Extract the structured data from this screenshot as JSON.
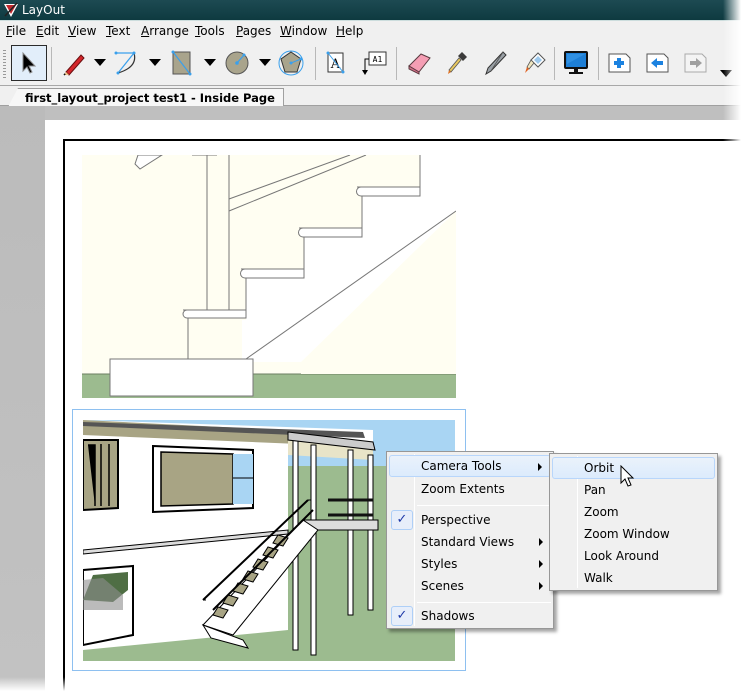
{
  "window": {
    "title": "LayOut"
  },
  "menubar": {
    "items": [
      {
        "label": "File",
        "accel": "F",
        "rest": "ile"
      },
      {
        "label": "Edit",
        "accel": "E",
        "rest": "dit"
      },
      {
        "label": "View",
        "accel": "V",
        "rest": "iew"
      },
      {
        "label": "Text",
        "accel": "T",
        "rest": "ext"
      },
      {
        "label": "Arrange",
        "accel": "A",
        "rest": "rrange"
      },
      {
        "label": "Tools",
        "accel": "T",
        "rest": "ools"
      },
      {
        "label": "Pages",
        "accel": "P",
        "rest": "ages"
      },
      {
        "label": "Window",
        "accel": "W",
        "rest": "indow"
      },
      {
        "label": "Help",
        "accel": "H",
        "rest": "elp"
      }
    ]
  },
  "toolbar": {
    "tools": [
      {
        "name": "select",
        "icon": "arrow-cursor-icon",
        "active": true
      },
      {
        "name": "pencil",
        "icon": "pencil-icon"
      },
      {
        "name": "arc",
        "icon": "arc-icon"
      },
      {
        "name": "rectangle",
        "icon": "rectangle-icon"
      },
      {
        "name": "circle",
        "icon": "circle-icon"
      },
      {
        "name": "polygon",
        "icon": "polygon-icon"
      },
      {
        "name": "text",
        "icon": "text-icon"
      },
      {
        "name": "label",
        "icon": "label-icon"
      },
      {
        "name": "eraser",
        "icon": "eraser-icon"
      },
      {
        "name": "style",
        "icon": "eyedropper-icon"
      },
      {
        "name": "split",
        "icon": "split-blade-icon"
      },
      {
        "name": "join",
        "icon": "glue-bottle-icon"
      },
      {
        "name": "presentation",
        "icon": "monitor-icon"
      },
      {
        "name": "add-page",
        "icon": "add-page-icon"
      },
      {
        "name": "previous-page",
        "icon": "previous-page-icon"
      },
      {
        "name": "next-page",
        "icon": "next-page-icon",
        "disabled": true
      }
    ]
  },
  "document_tab": {
    "label": "first_layout_project test1 - Inside Page"
  },
  "context_menu": {
    "items": [
      {
        "label": "Camera Tools",
        "submenu": true,
        "highlighted": true
      },
      {
        "label": "Zoom Extents"
      },
      {
        "separator": true
      },
      {
        "label": "Perspective",
        "checked": true
      },
      {
        "label": "Standard Views",
        "submenu": true
      },
      {
        "label": "Styles",
        "submenu": true
      },
      {
        "label": "Scenes",
        "submenu": true
      },
      {
        "separator": true
      },
      {
        "label": "Shadows",
        "checked": true
      }
    ]
  },
  "submenu": {
    "items": [
      {
        "label": "Orbit",
        "highlighted": true
      },
      {
        "label": "Pan"
      },
      {
        "label": "Zoom"
      },
      {
        "label": "Zoom Window"
      },
      {
        "label": "Look Around"
      },
      {
        "label": "Walk"
      }
    ]
  },
  "colors": {
    "titlebar": "#0e3a40",
    "wall": "#fffef2",
    "grass": "#9cbb8f",
    "sky": "#a9d5f3",
    "selection": "#8ec0f0",
    "check": "#1f3aa8"
  }
}
